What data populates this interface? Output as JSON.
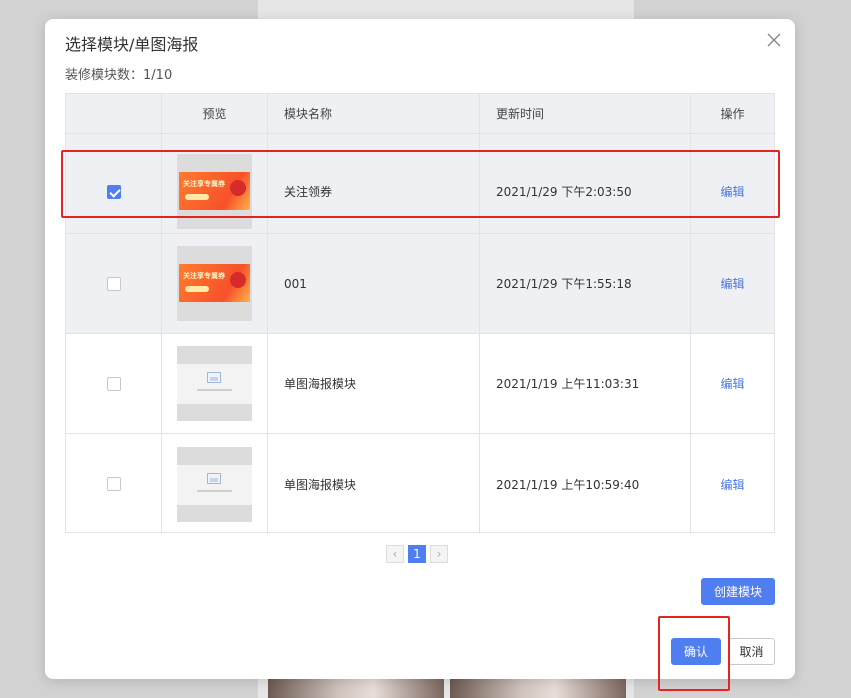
{
  "dialog": {
    "title": "选择模块/单图海报",
    "count_label": "装修模块数：",
    "count_value": "1/10"
  },
  "table": {
    "headers": {
      "preview": "预览",
      "name": "模块名称",
      "time": "更新时间",
      "action": "操作"
    },
    "rows": [
      {
        "checked": true,
        "thumb": "coupon-banner",
        "name": "关注领券",
        "time": "2021/1/29 下午2:03:50",
        "action": "编辑",
        "banner_text": "关注享专属券"
      },
      {
        "checked": false,
        "thumb": "coupon-banner",
        "name": "001",
        "time": "2021/1/29 下午1:55:18",
        "action": "编辑",
        "banner_text": "关注享专属券"
      },
      {
        "checked": false,
        "thumb": "placeholder-image",
        "name": "单图海报模块",
        "time": "2021/1/19 上午11:03:31",
        "action": "编辑"
      },
      {
        "checked": false,
        "thumb": "placeholder-image",
        "name": "单图海报模块",
        "time": "2021/1/19 上午10:59:40",
        "action": "编辑"
      }
    ]
  },
  "pagination": {
    "prev": "‹",
    "current": "1",
    "next": "›"
  },
  "buttons": {
    "create": "创建模块",
    "confirm": "确认",
    "cancel": "取消"
  },
  "colors": {
    "primary": "#4f7ef0",
    "link": "#4a78e0",
    "annotation": "#e5231f",
    "row_highlight": "#eef0f4"
  },
  "icons": {
    "close": "close-icon",
    "checkbox": "checkbox-icon",
    "image_placeholder": "image-placeholder-icon"
  }
}
